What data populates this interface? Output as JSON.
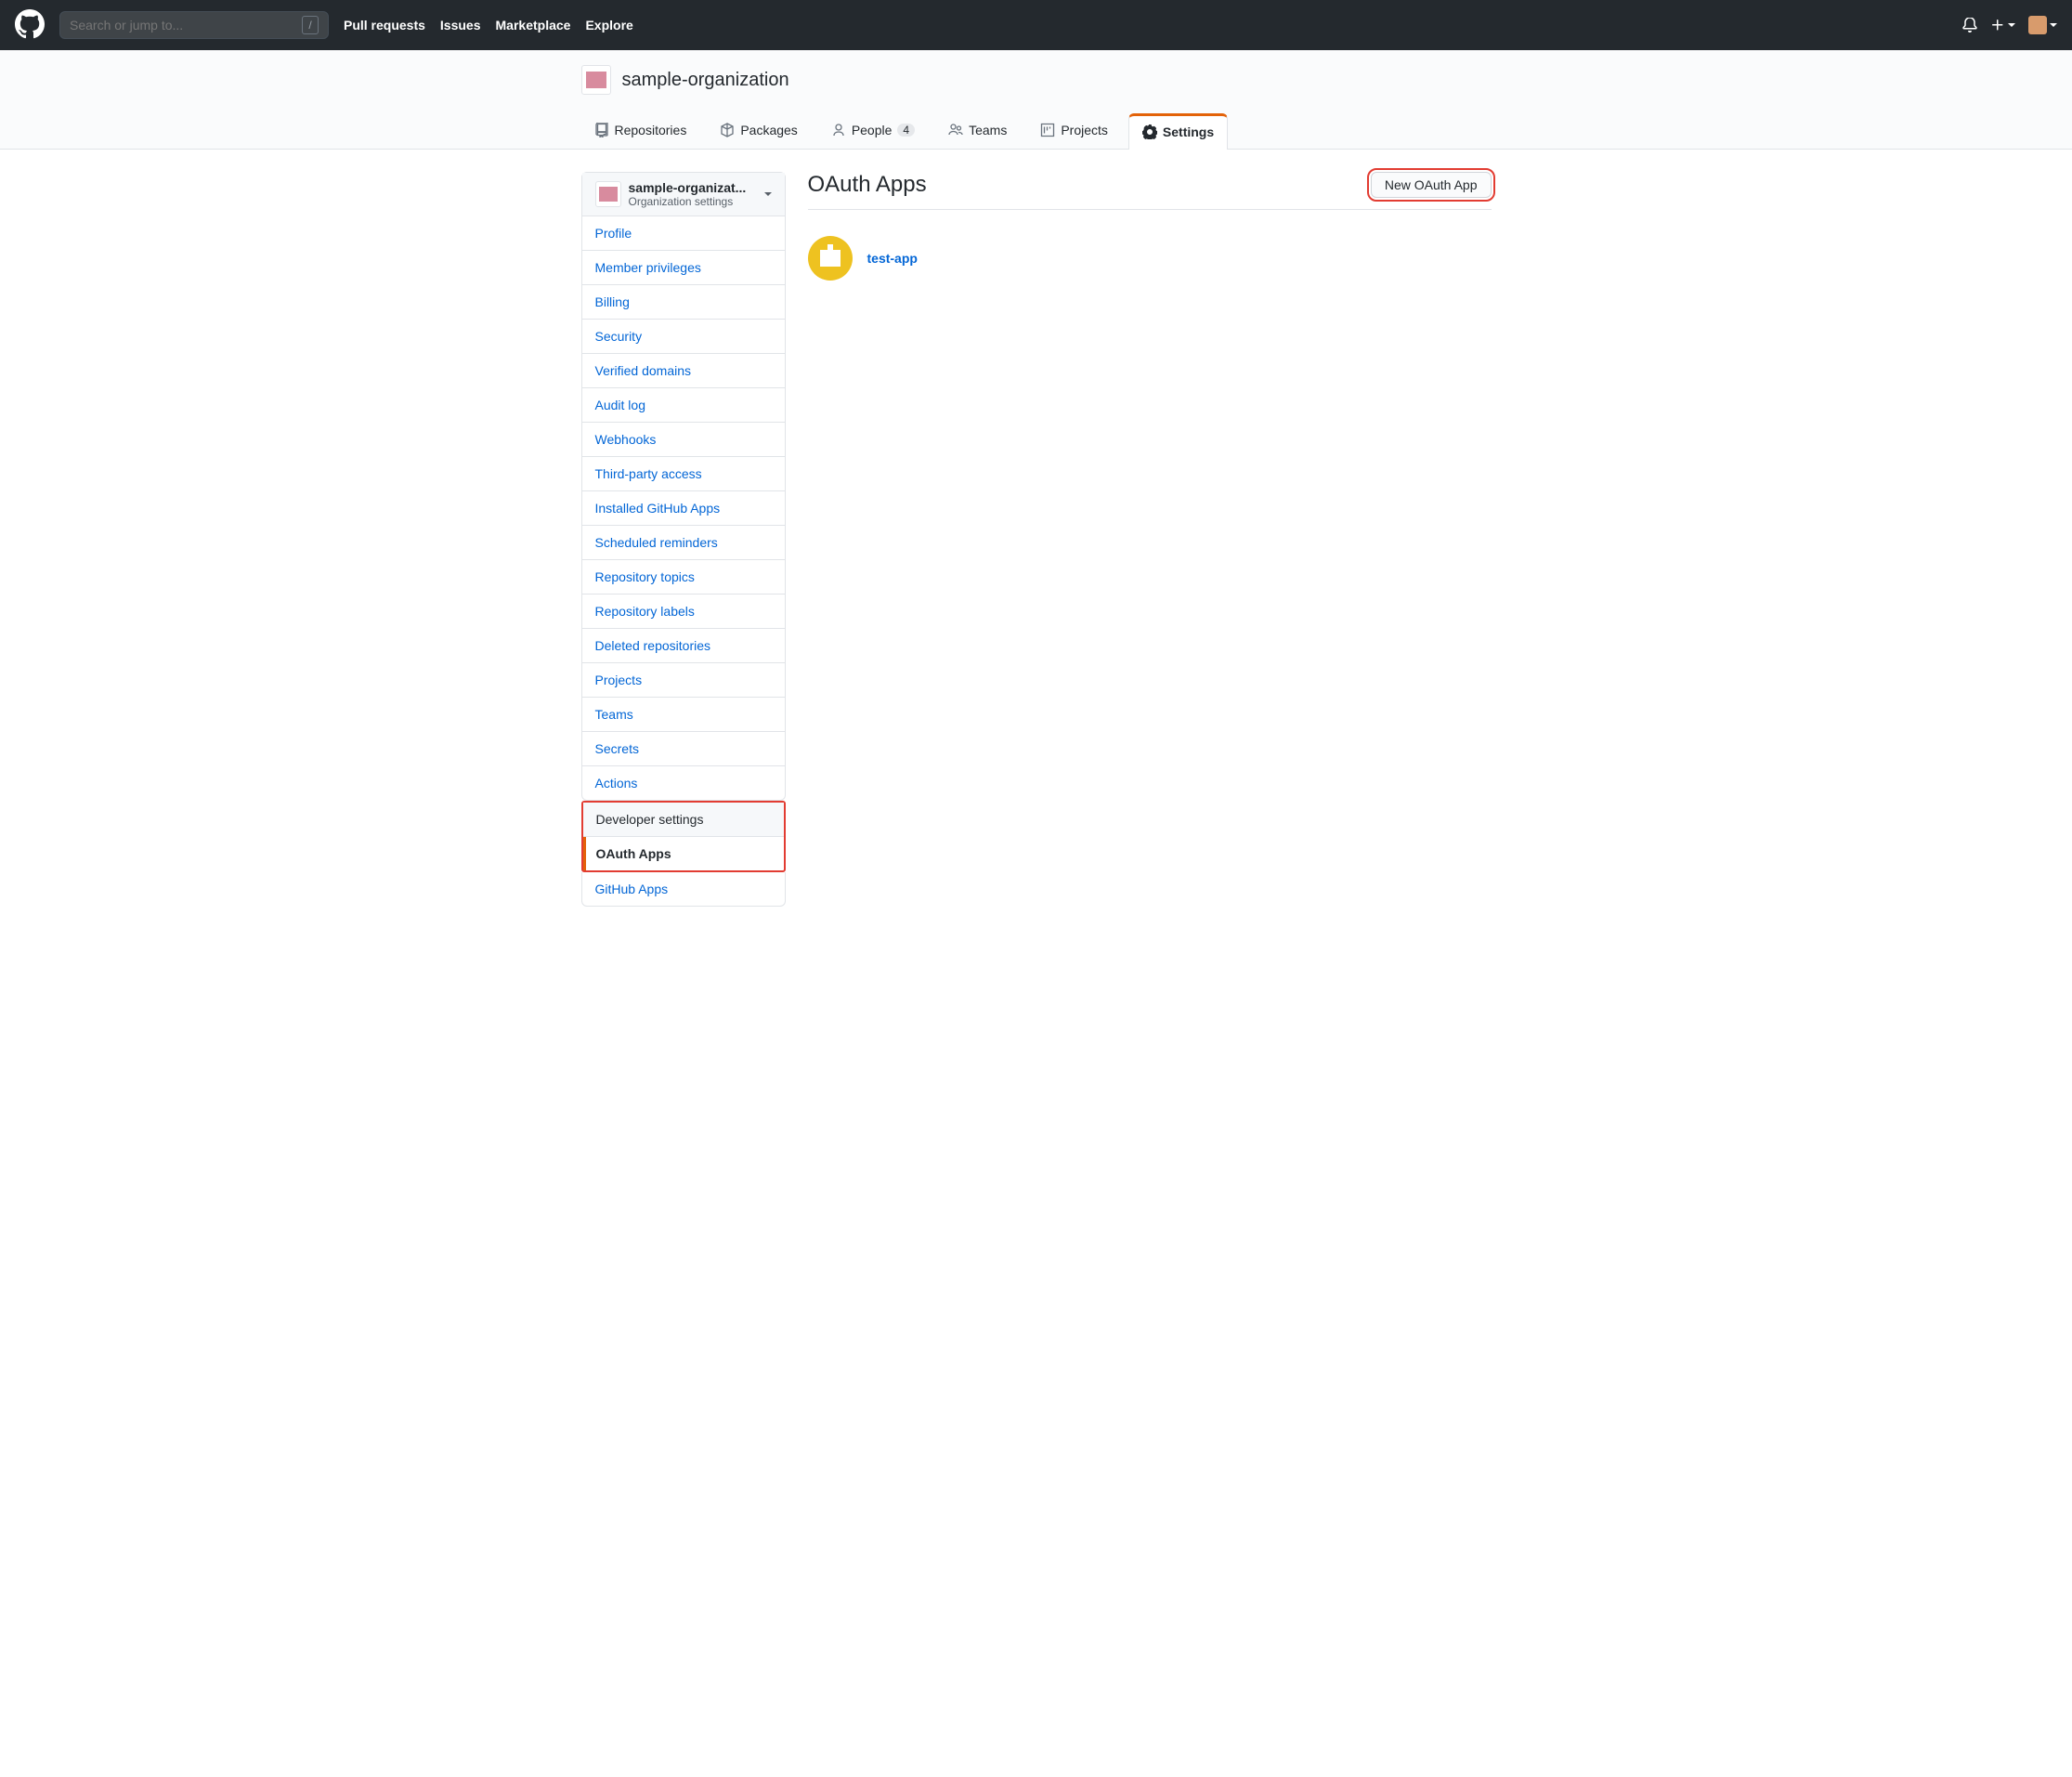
{
  "header": {
    "search_placeholder": "Search or jump to...",
    "slash_key": "/",
    "nav": [
      "Pull requests",
      "Issues",
      "Marketplace",
      "Explore"
    ]
  },
  "org": {
    "name": "sample-organization"
  },
  "tabs": [
    {
      "label": "Repositories",
      "icon": "repo"
    },
    {
      "label": "Packages",
      "icon": "package"
    },
    {
      "label": "People",
      "icon": "person",
      "count": "4"
    },
    {
      "label": "Teams",
      "icon": "people"
    },
    {
      "label": "Projects",
      "icon": "project"
    },
    {
      "label": "Settings",
      "icon": "gear",
      "active": true
    }
  ],
  "sidebar": {
    "org_selector": {
      "title": "sample-organizat...",
      "subtitle": "Organization settings"
    },
    "main_menu": [
      "Profile",
      "Member privileges",
      "Billing",
      "Security",
      "Verified domains",
      "Audit log",
      "Webhooks",
      "Third-party access",
      "Installed GitHub Apps",
      "Scheduled reminders",
      "Repository topics",
      "Repository labels",
      "Deleted repositories",
      "Projects",
      "Teams",
      "Secrets",
      "Actions"
    ],
    "dev_menu": {
      "heading": "Developer settings",
      "items": [
        {
          "label": "OAuth Apps",
          "selected": true
        },
        {
          "label": "GitHub Apps",
          "selected": false
        }
      ]
    }
  },
  "page": {
    "title": "OAuth Apps",
    "new_button": "New OAuth App",
    "apps": [
      {
        "name": "test-app"
      }
    ]
  }
}
